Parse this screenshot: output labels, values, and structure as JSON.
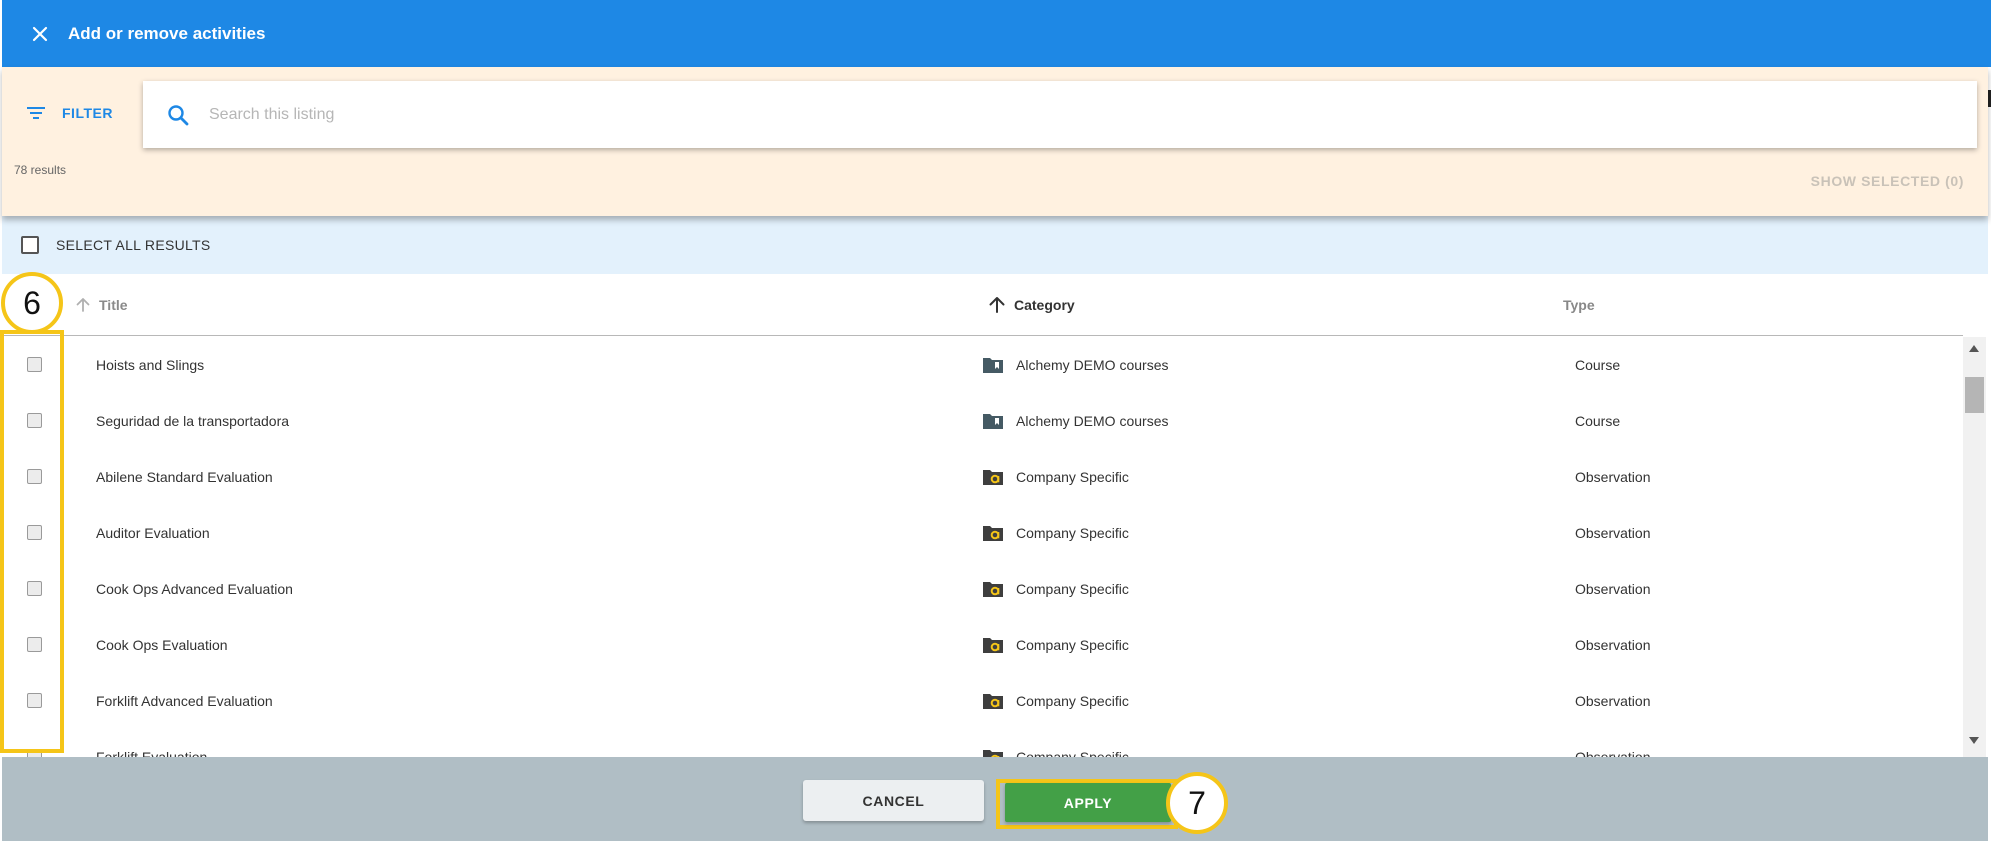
{
  "topbar": {
    "title": "Add or remove activities",
    "close_icon": "close-icon",
    "color": "#1e88e5"
  },
  "filterbar": {
    "filter_label": "FILTER",
    "search_placeholder": "Search this listing",
    "search_value": "",
    "results_count": "78 results",
    "show_selected_label": "SHOW SELECTED (0)"
  },
  "select_all": {
    "label": "SELECT ALL RESULTS",
    "checked": false
  },
  "table": {
    "columns": {
      "title": "Title",
      "category": "Category",
      "type": "Type"
    },
    "rows": [
      {
        "title": "Hoists and Slings",
        "category": "Alchemy DEMO courses",
        "category_icon": "course-folder-icon",
        "type": "Course"
      },
      {
        "title": "Seguridad de la transportadora",
        "category": "Alchemy DEMO courses",
        "category_icon": "course-folder-icon",
        "type": "Course"
      },
      {
        "title": "Abilene Standard Evaluation",
        "category": "Company Specific",
        "category_icon": "company-folder-icon",
        "type": "Observation"
      },
      {
        "title": "Auditor Evaluation",
        "category": "Company Specific",
        "category_icon": "company-folder-icon",
        "type": "Observation"
      },
      {
        "title": "Cook Ops Advanced Evaluation",
        "category": "Company Specific",
        "category_icon": "company-folder-icon",
        "type": "Observation"
      },
      {
        "title": "Cook Ops Evaluation",
        "category": "Company Specific",
        "category_icon": "company-folder-icon",
        "type": "Observation"
      },
      {
        "title": "Forklift Advanced Evaluation",
        "category": "Company Specific",
        "category_icon": "company-folder-icon",
        "type": "Observation"
      },
      {
        "title": "Forklift Evaluation",
        "category": "Company Specific",
        "category_icon": "company-folder-icon",
        "type": "Observation"
      }
    ]
  },
  "footer": {
    "cancel_label": "CANCEL",
    "apply_label": "APPLY",
    "apply_color": "#43a047"
  },
  "callouts": {
    "checkbox_step": "6",
    "apply_step": "7",
    "highlight_color": "#f5c518"
  }
}
